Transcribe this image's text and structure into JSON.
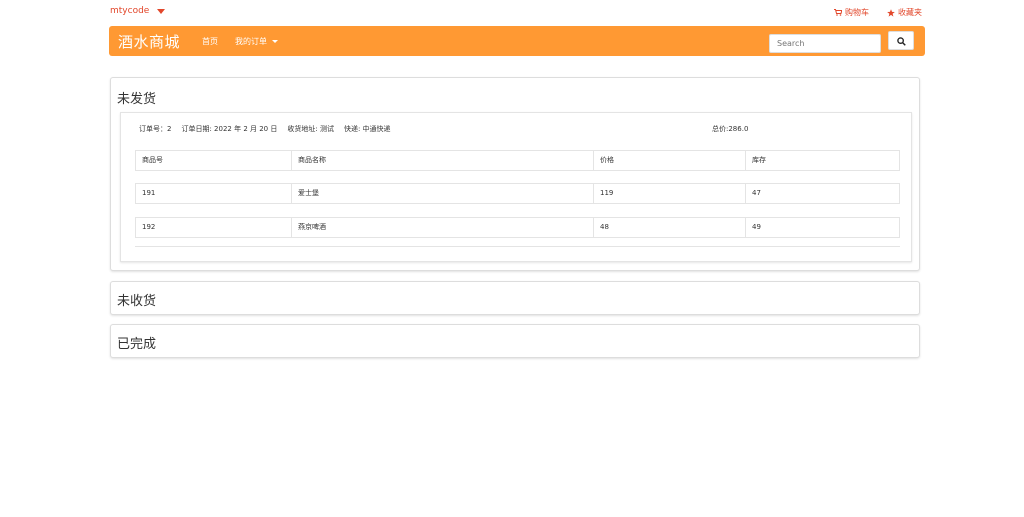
{
  "topbar": {
    "username": "mtycode",
    "cart_label": "购物车",
    "favorites_label": "收藏夹"
  },
  "navbar": {
    "brand": "酒水商城",
    "home_label": "首页",
    "my_orders_label": "我的订单",
    "search_placeholder": "Search"
  },
  "sections": {
    "unshipped": {
      "title": "未发货",
      "order": {
        "number_text": "订单号：2",
        "date_text": "订单日期: 2022 年 2 月 20 日",
        "address_text": "收货地址: 测试",
        "courier_text": "快递: 中通快递",
        "total_text": "总价:286.0"
      },
      "table": {
        "headers": [
          "商品号",
          "商品名称",
          "价格",
          "库存"
        ],
        "rows": [
          [
            "191",
            "爱士堡",
            "119",
            "47"
          ],
          [
            "192",
            "燕京啤酒",
            "48",
            "49"
          ]
        ]
      }
    },
    "unreceived": {
      "title": "未收货"
    },
    "completed": {
      "title": "已完成"
    }
  },
  "colors": {
    "brand_orange": "#ff9933",
    "link_red": "#e2472b"
  }
}
